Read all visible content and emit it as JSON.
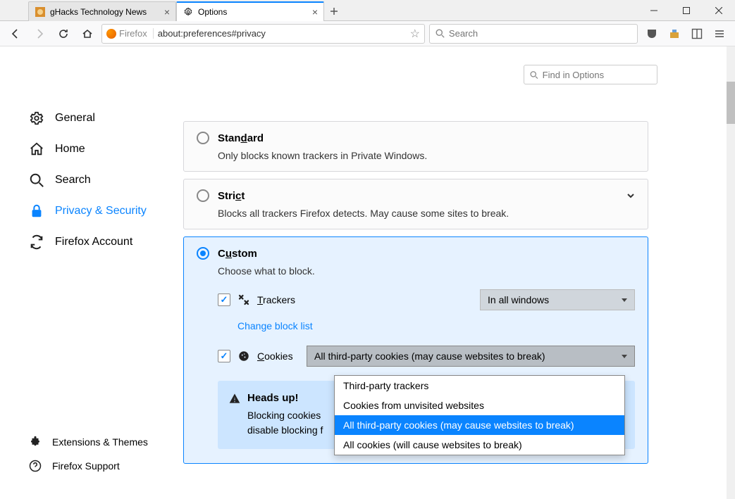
{
  "window": {
    "tabs": [
      {
        "label": "gHacks Technology News",
        "active": false
      },
      {
        "label": "Options",
        "active": true
      }
    ]
  },
  "toolbar": {
    "identity_label": "Firefox",
    "url": "about:preferences#privacy",
    "search_placeholder": "Search"
  },
  "find": {
    "placeholder": "Find in Options"
  },
  "sidebar": {
    "items": [
      {
        "label": "General"
      },
      {
        "label": "Home"
      },
      {
        "label": "Search"
      },
      {
        "label": "Privacy & Security"
      },
      {
        "label": "Firefox Account"
      }
    ],
    "bottom": [
      {
        "label": "Extensions & Themes"
      },
      {
        "label": "Firefox Support"
      }
    ]
  },
  "blocking": {
    "standard": {
      "title_pre": "Stan",
      "title_ul": "d",
      "title_post": "ard",
      "desc": "Only blocks known trackers in Private Windows."
    },
    "strict": {
      "title_pre": "Stri",
      "title_ul": "c",
      "title_post": "t",
      "desc": "Blocks all trackers Firefox detects. May cause some sites to break."
    },
    "custom": {
      "title_pre": "C",
      "title_ul": "u",
      "title_post": "stom",
      "desc": "Choose what to block.",
      "trackers": {
        "label_ul": "T",
        "label_post": "rackers",
        "dropdown": "In all windows"
      },
      "change_block_list": "Change block list",
      "cookies": {
        "label_ul": "C",
        "label_post": "ookies",
        "selected": "All third-party cookies (may cause websites to break)",
        "options": [
          "Third-party trackers",
          "Cookies from unvisited websites",
          "All third-party cookies (may cause websites to break)",
          "All cookies (will cause websites to break)"
        ]
      },
      "warning": {
        "title": "Heads up!",
        "text1": "Blocking cookies",
        "text2": "disable blocking f"
      }
    }
  }
}
